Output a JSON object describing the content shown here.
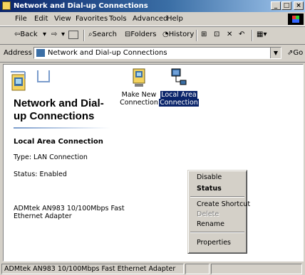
{
  "window": {
    "title": "Network and Dial-up Connections",
    "buttons": [
      "_",
      "□",
      "×"
    ]
  },
  "menu": [
    "File",
    "Edit",
    "View",
    "Favorites",
    "Tools",
    "Advanced",
    "Help"
  ],
  "toolbar": {
    "back": "⇦Back",
    "forward": "⇨",
    "up_icon": "up-folder-icon",
    "search": "Search",
    "folders": "Folders",
    "history": "History",
    "views_icon": "views-icon"
  },
  "address": {
    "label": "Address",
    "value": "Network and Dial-up Connections",
    "go": "Go"
  },
  "panel": {
    "title": "Network and Dial-up Connections",
    "section_title": "Local Area Connection",
    "type": "Type: LAN Connection",
    "status": "Status: Enabled",
    "adapter": "ADMtek AN983 10/100Mbps Fast Ethernet Adapter"
  },
  "items": [
    {
      "label_line1": "Make New",
      "label_line2": "Connection"
    },
    {
      "label_line1": "Local Area",
      "label_line2": "Connection"
    }
  ],
  "context_menu": {
    "disable": "Disable",
    "status": "Status",
    "create_shortcut": "Create Shortcut",
    "delete": "Delete",
    "rename": "Rename",
    "properties": "Properties"
  },
  "statusbar": {
    "text": "ADMtek AN983 10/100Mbps Fast Ethernet Adapter"
  },
  "colors": {
    "title_active": "#0a246a",
    "face": "#d4d0c8",
    "selection": "#0a246a"
  }
}
